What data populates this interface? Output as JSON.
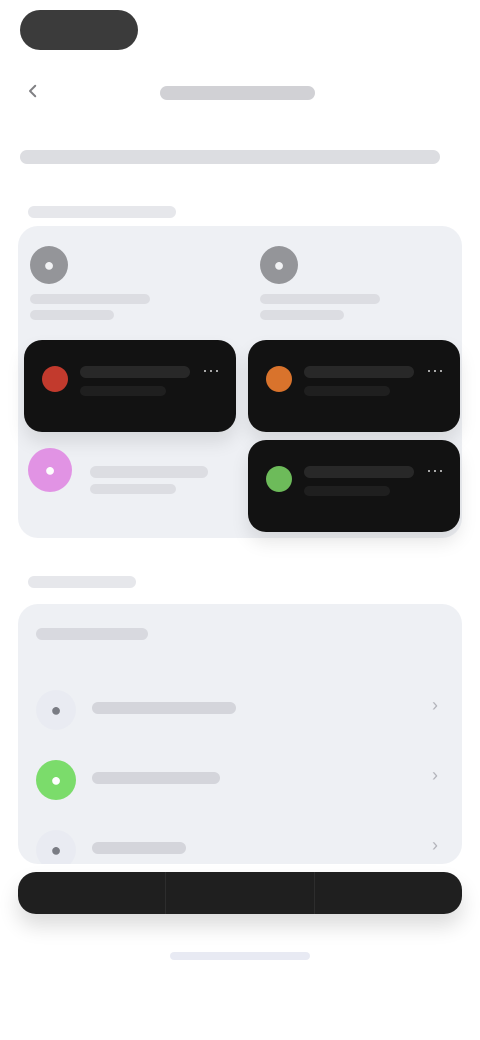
{
  "status_bar": {
    "time": ""
  },
  "top_bar": {
    "title": ""
  },
  "subtitle": {
    "text": ""
  },
  "devices": {
    "section_label": "",
    "placeholders": [
      {
        "label_1": "",
        "label_2": ""
      },
      {
        "label_1": "",
        "label_2": ""
      }
    ],
    "cards": [
      {
        "title": "",
        "subtitle": "",
        "accent_color": "#c23a2d"
      },
      {
        "title": "",
        "subtitle": "",
        "accent_color": "#d9732c"
      },
      {
        "title": "",
        "subtitle": "",
        "accent_color": "#6dbb5a"
      }
    ],
    "pink_accent_color": "#e08ae3"
  },
  "settings": {
    "section_label": "",
    "header": "",
    "rows": [
      {
        "label": "",
        "icon_color": "#e9ebf2"
      },
      {
        "label": "",
        "icon_color": "#7bdc6b"
      },
      {
        "label": "",
        "icon_color": "#e9ebf2"
      }
    ]
  },
  "bottom_bar": {
    "left": "",
    "middle": "",
    "right": ""
  }
}
